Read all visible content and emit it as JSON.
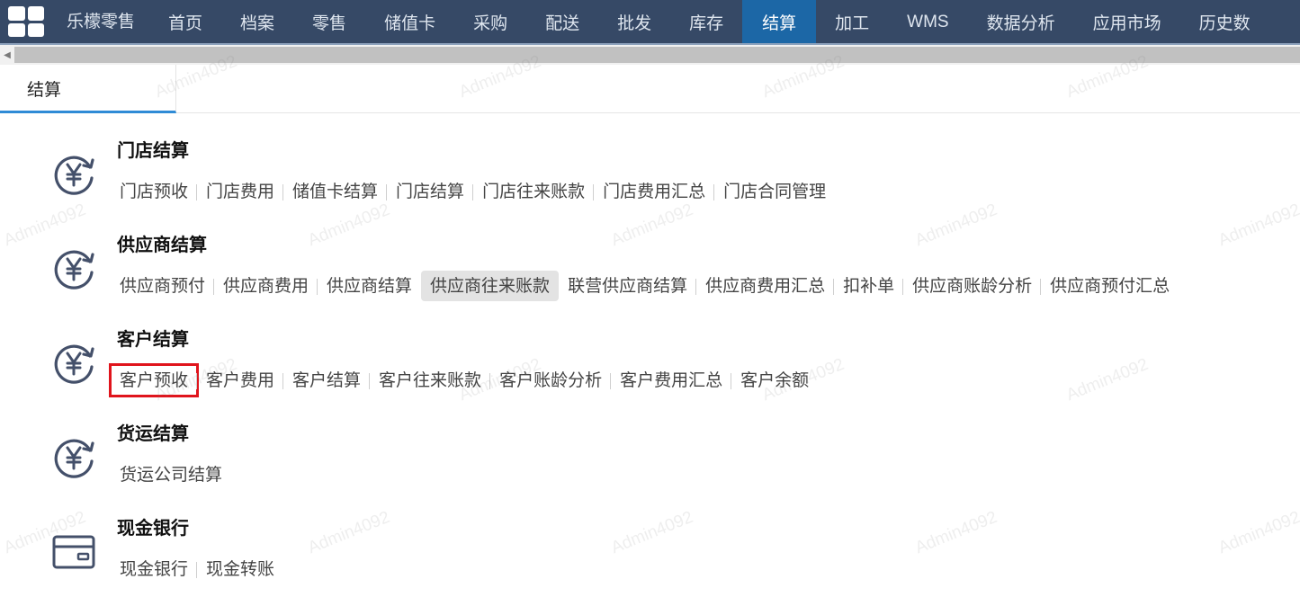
{
  "nav": {
    "brand": "乐檬零售",
    "items": [
      "首页",
      "档案",
      "零售",
      "储值卡",
      "采购",
      "配送",
      "批发",
      "库存",
      "结算",
      "加工",
      "WMS",
      "数据分析",
      "应用市场",
      "历史数"
    ],
    "active": "结算"
  },
  "tab": {
    "label": "结算"
  },
  "watermark": "Admin4092",
  "sections": [
    {
      "title": "门店结算",
      "icon": "yen-refresh-icon",
      "links": [
        "门店预收",
        "门店费用",
        "储值卡结算",
        "门店结算",
        "门店往来账款",
        "门店费用汇总",
        "门店合同管理"
      ]
    },
    {
      "title": "供应商结算",
      "icon": "yen-refresh-icon",
      "links": [
        "供应商预付",
        "供应商费用",
        "供应商结算",
        "供应商往来账款",
        "联营供应商结算",
        "供应商费用汇总",
        "扣补单",
        "供应商账龄分析",
        "供应商预付汇总"
      ],
      "hovered": "供应商往来账款"
    },
    {
      "title": "客户结算",
      "icon": "yen-refresh-icon",
      "links": [
        "客户预收",
        "客户费用",
        "客户结算",
        "客户往来账款",
        "客户账龄分析",
        "客户费用汇总",
        "客户余额"
      ],
      "highlighted": "客户预收"
    },
    {
      "title": "货运结算",
      "icon": "yen-refresh-icon",
      "links": [
        "货运公司结算"
      ]
    },
    {
      "title": "现金银行",
      "icon": "card-icon",
      "links": [
        "现金银行",
        "现金转账"
      ]
    }
  ],
  "colors": {
    "nav_bg": "#364966",
    "nav_active": "#1c67a6",
    "tab_underline": "#2f8bd6",
    "highlight_box": "#e0141c"
  }
}
